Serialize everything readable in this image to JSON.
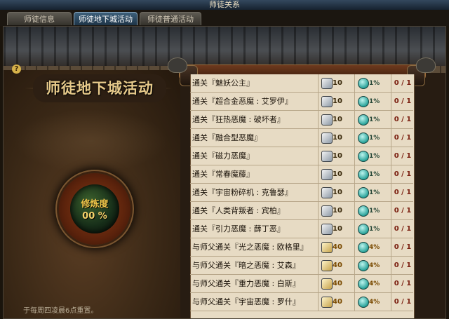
{
  "window": {
    "title": "师徒关系"
  },
  "tabs": [
    {
      "label": "师徒信息",
      "active": false
    },
    {
      "label": "师徒地下城活动",
      "active": true
    },
    {
      "label": "师徒普通活动",
      "active": false
    }
  ],
  "help": {
    "symbol": "?"
  },
  "section": {
    "title": "师徒地下城活动"
  },
  "cultivation": {
    "label": "修炼度",
    "value": "00 %"
  },
  "reset_note": "于每周四凌晨6点重置。",
  "icons": {
    "reward": "ticket-icon",
    "chance": "orb-icon"
  },
  "activities": [
    {
      "name": "通关『魅妖公主』",
      "reward": "10",
      "chance": "1%",
      "progress": "0 / 1",
      "tier": "normal"
    },
    {
      "name": "通关『超合金恶魔 : 艾罗伊』",
      "reward": "10",
      "chance": "1%",
      "progress": "0 / 1",
      "tier": "normal"
    },
    {
      "name": "通关『狂热恶魔 : 破坏者』",
      "reward": "10",
      "chance": "1%",
      "progress": "0 / 1",
      "tier": "normal"
    },
    {
      "name": "通关『融合型恶魔』",
      "reward": "10",
      "chance": "1%",
      "progress": "0 / 1",
      "tier": "normal"
    },
    {
      "name": "通关『磁力恶魔』",
      "reward": "10",
      "chance": "1%",
      "progress": "0 / 1",
      "tier": "normal"
    },
    {
      "name": "通关『常春魔藤』",
      "reward": "10",
      "chance": "1%",
      "progress": "0 / 1",
      "tier": "normal"
    },
    {
      "name": "通关『宇宙粉碎机 : 克鲁瑟』",
      "reward": "10",
      "chance": "1%",
      "progress": "0 / 1",
      "tier": "normal"
    },
    {
      "name": "通关『人类背叛者 : 宾柏』",
      "reward": "10",
      "chance": "1%",
      "progress": "0 / 1",
      "tier": "normal"
    },
    {
      "name": "通关『引力恶魔 : 薛丁恶』",
      "reward": "10",
      "chance": "1%",
      "progress": "0 / 1",
      "tier": "normal"
    },
    {
      "name": "与师父通关『光之恶魔 : 欧格里』",
      "reward": "40",
      "chance": "4%",
      "progress": "0 / 1",
      "tier": "master"
    },
    {
      "name": "与师父通关『暗之恶魔 : 艾森』",
      "reward": "40",
      "chance": "4%",
      "progress": "0 / 1",
      "tier": "master"
    },
    {
      "name": "与师父通关『重力恶魔 : 白斯』",
      "reward": "40",
      "chance": "4%",
      "progress": "0 / 1",
      "tier": "master"
    },
    {
      "name": "与师父通关『宇宙恶魔 : 罗什』",
      "reward": "40",
      "chance": "4%",
      "progress": "0 / 1",
      "tier": "master"
    }
  ]
}
